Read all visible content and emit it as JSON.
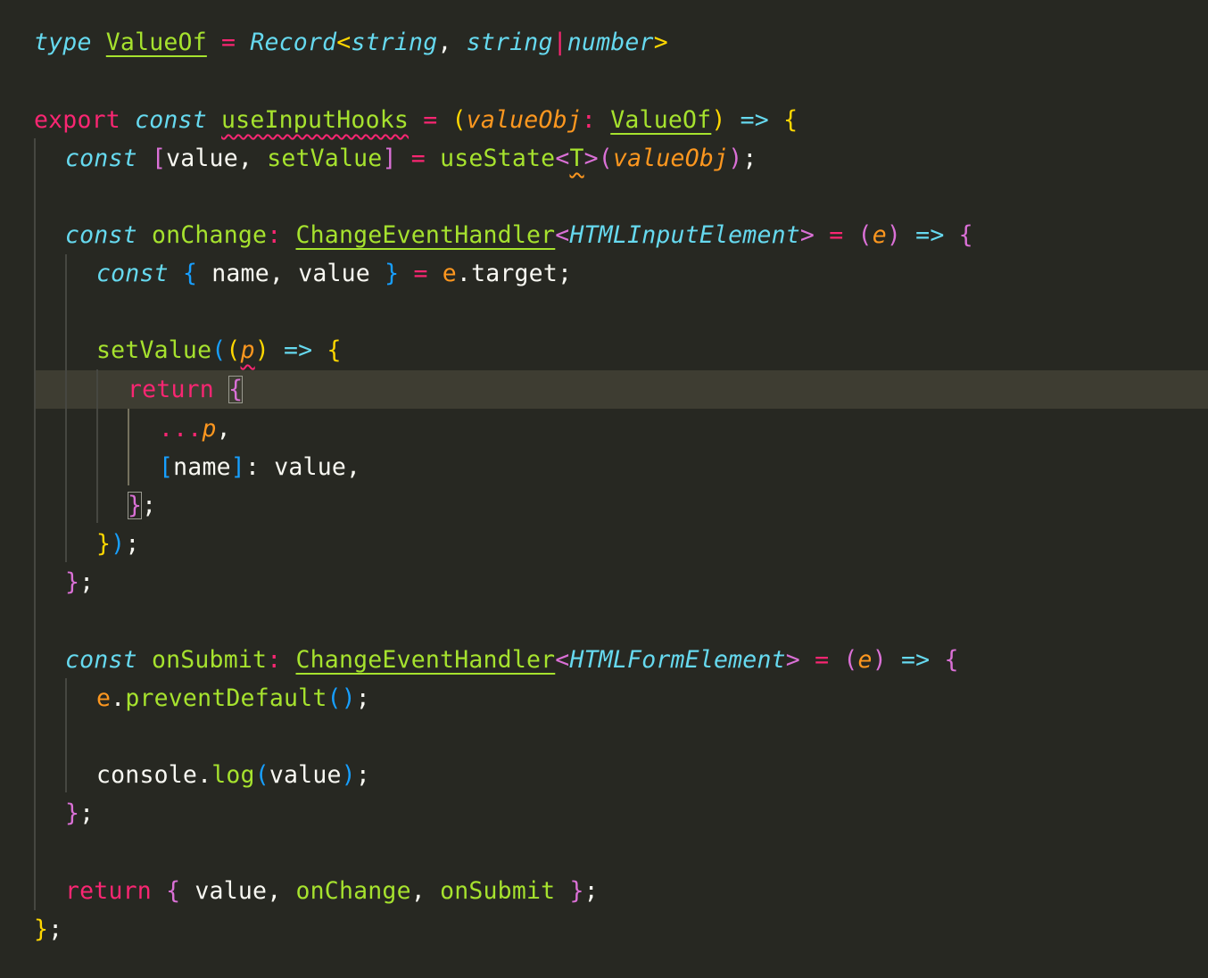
{
  "editor": {
    "theme_colors": {
      "background": "#272822",
      "keyword": "#66D9EF",
      "operator": "#F92672",
      "function": "#A6E22E",
      "parameter": "#FD971F",
      "text": "#F8F8F2",
      "bracket_1": "#FFD700",
      "bracket_2": "#DA70D6",
      "bracket_3": "#179FFF",
      "line_highlight": "#3E3D32"
    },
    "tokens": {
      "l1": [
        "type",
        " ",
        "ValueOf",
        " ",
        "=",
        " ",
        "Record",
        "<",
        "string",
        ", ",
        "string",
        "|",
        "number",
        ">"
      ],
      "l3": [
        "export",
        " ",
        "const",
        " ",
        "useInputHooks",
        " ",
        "=",
        " ",
        "(",
        "valueObj",
        ":",
        " ",
        "ValueOf",
        ")",
        " ",
        "=>",
        " ",
        "{"
      ],
      "l4": [
        "const",
        " ",
        "[",
        "value",
        ", ",
        "setValue",
        "]",
        " ",
        "=",
        " ",
        "useState",
        "<",
        "T",
        ">",
        "(",
        "valueObj",
        ")",
        ";"
      ],
      "l6": [
        "const",
        " ",
        "onChange",
        ":",
        " ",
        "ChangeEventHandler",
        "<",
        "HTMLInputElement",
        ">",
        " ",
        "=",
        " ",
        "(",
        "e",
        ")",
        " ",
        "=>",
        " ",
        "{"
      ],
      "l7": [
        "const",
        " ",
        "{",
        " ",
        "name",
        ", ",
        "value",
        " ",
        "}",
        " ",
        "=",
        " ",
        "e",
        ".",
        "target",
        ";"
      ],
      "l9": [
        "setValue",
        "(",
        "(",
        "p",
        ")",
        " ",
        "=>",
        " ",
        "{"
      ],
      "l10": [
        "return",
        " ",
        "{"
      ],
      "l11": [
        "...",
        "p",
        ","
      ],
      "l12": [
        "[",
        "name",
        "]",
        ":",
        " ",
        "value",
        ","
      ],
      "l13": [
        "}",
        ";"
      ],
      "l14": [
        "}",
        ")",
        ";"
      ],
      "l15": [
        "}",
        ";"
      ],
      "l17": [
        "const",
        " ",
        "onSubmit",
        ":",
        " ",
        "ChangeEventHandler",
        "<",
        "HTMLFormElement",
        ">",
        " ",
        "=",
        " ",
        "(",
        "e",
        ")",
        " ",
        "=>",
        " ",
        "{"
      ],
      "l18": [
        "e",
        ".",
        "preventDefault",
        "(",
        ")",
        ";"
      ],
      "l20": [
        "console",
        ".",
        "log",
        "(",
        "value",
        ")",
        ";"
      ],
      "l21": [
        "}",
        ";"
      ],
      "l23": [
        "return",
        " ",
        "{",
        " ",
        "value",
        ", ",
        "onChange",
        ", ",
        "onSubmit",
        " ",
        "}",
        ";"
      ],
      "l24": [
        "}",
        ";"
      ]
    }
  }
}
